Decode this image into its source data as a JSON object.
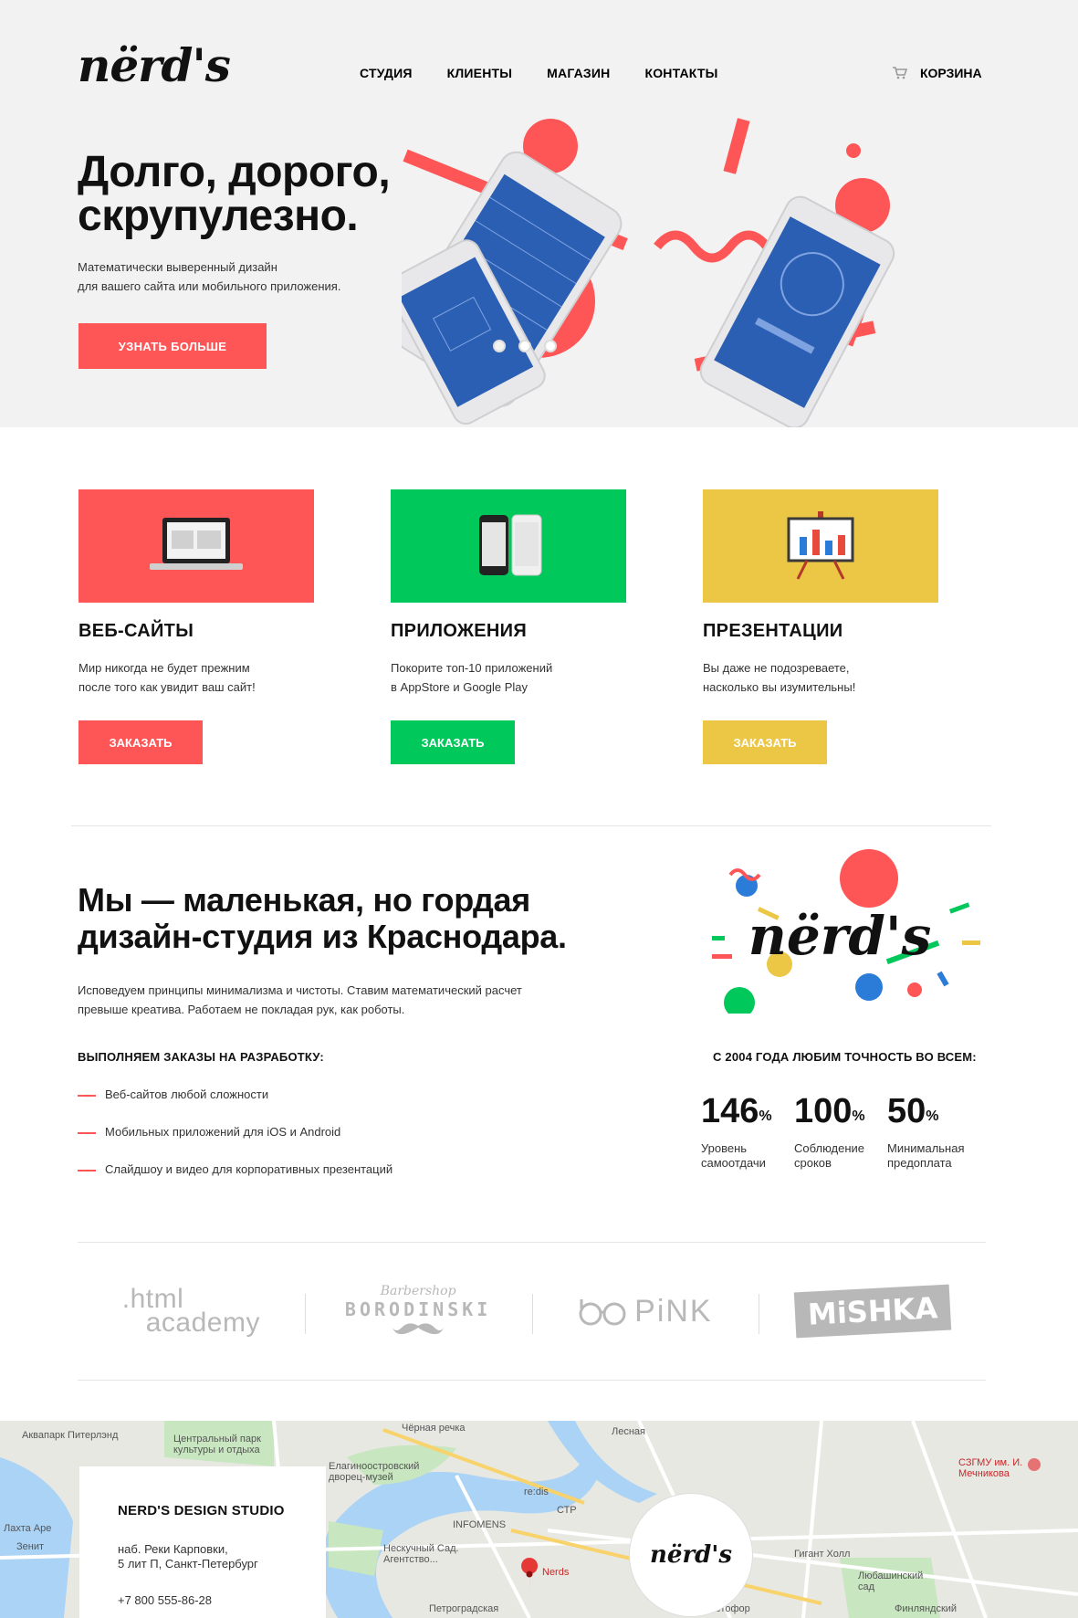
{
  "header": {
    "logo_text": "nërd's",
    "nav": [
      "СТУДИЯ",
      "КЛИЕНТЫ",
      "МАГАЗИН",
      "КОНТАКТЫ"
    ],
    "cart_label": "КОРЗИНА"
  },
  "hero": {
    "title_line1": "Долго, дорого,",
    "title_line2": "скрупулезно.",
    "subtitle_line1": "Математически выверенный дизайн",
    "subtitle_line2": "для вашего сайта или мобильного приложения.",
    "cta": "УЗНАТЬ БОЛЬШЕ"
  },
  "services": [
    {
      "title": "ВЕБ-САЙТЫ",
      "text_line1": "Мир никогда не будет прежним",
      "text_line2": "после того как увидит ваш сайт!",
      "button": "ЗАКАЗАТЬ",
      "color": "#fe5656",
      "icon": "laptop-icon"
    },
    {
      "title": "ПРИЛОЖЕНИЯ",
      "text_line1": "Покорите топ-10 приложений",
      "text_line2": "в AppStore и Google Play",
      "button": "ЗАКАЗАТЬ",
      "color": "#00c85a",
      "icon": "phones-icon"
    },
    {
      "title": "ПРЕЗЕНТАЦИИ",
      "text_line1": "Вы даже не подозреваете,",
      "text_line2": "насколько вы изумительны!",
      "button": "ЗАКАЗАТЬ",
      "color": "#ecc645",
      "icon": "presentation-board-icon"
    }
  ],
  "about": {
    "title_line1": "Мы — маленькая, но гордая",
    "title_line2": "дизайн-студия из Краснодара.",
    "text_line1": "Исповедуем принципы минимализма и чистоты. Ставим математический расчет",
    "text_line2": "превыше креатива. Работаем не покладая рук, как роботы.",
    "list_label": "ВЫПОЛНЯЕМ ЗАКАЗЫ НА РАЗРАБОТКУ:",
    "list": [
      "Веб-сайтов любой сложности",
      "Мобильных приложений для iOS и Android",
      "Слайдшоу и видео для корпоративных презентаций"
    ],
    "logo_text": "nërd's",
    "stats_label": "С 2004 ГОДА ЛЮБИМ ТОЧНОСТЬ ВО ВСЕМ:",
    "stats": [
      {
        "value": "146",
        "unit": "%",
        "caption_line1": "Уровень",
        "caption_line2": "самоотдачи"
      },
      {
        "value": "100",
        "unit": "%",
        "caption_line1": "Соблюдение",
        "caption_line2": "сроков"
      },
      {
        "value": "50",
        "unit": "%",
        "caption_line1": "Минимальная",
        "caption_line2": "предоплата"
      }
    ]
  },
  "partners": {
    "html_academy_line1": ".html",
    "html_academy_line2": "academy",
    "borodinski_top": "Barbershop",
    "borodinski_main": "BORODINSKI",
    "pink": "PiNK",
    "mishka": "MiSHKA"
  },
  "map": {
    "card_title": "NERD'S DESIGN STUDIO",
    "address_line1": "наб. Реки Карповки,",
    "address_line2": "5 лит П, Санкт-Петербург",
    "phone": "+7 800 555-86-28",
    "bubble_logo": "nërd's",
    "labels": [
      "Аквапарк Питерлэнд",
      "Центральный парк культуры и отдыха",
      "Чёрная речка",
      "Лесная",
      "Елагиноостровский дворец-музей",
      "INFOMENS",
      "СТР",
      "Нескучный Сад. Агентство...",
      "Nerds",
      "Гигант Холл",
      "Любашинский сад",
      "Петроградская",
      "Зенит",
      "СЗГМУ им. И. Мечникова",
      "Лахта Аре",
      "Финляндский",
      "re:dis",
      "Светофор"
    ]
  }
}
